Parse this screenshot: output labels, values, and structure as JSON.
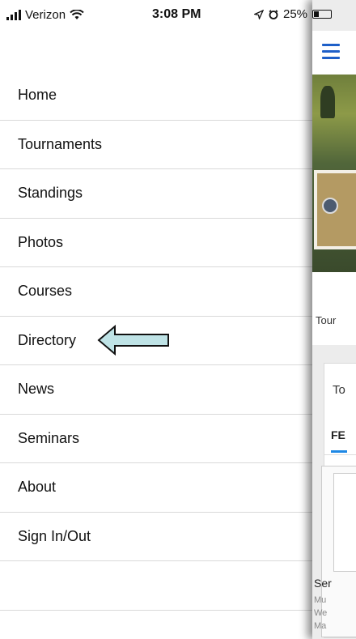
{
  "status_bar": {
    "carrier": "Verizon",
    "time": "3:08 PM",
    "battery": "25%"
  },
  "menu": {
    "items": [
      {
        "label": "Home"
      },
      {
        "label": "Tournaments"
      },
      {
        "label": "Standings"
      },
      {
        "label": "Photos"
      },
      {
        "label": "Courses"
      },
      {
        "label": "Directory"
      },
      {
        "label": "News"
      },
      {
        "label": "Seminars"
      },
      {
        "label": "About"
      },
      {
        "label": "Sign In/Out"
      }
    ]
  },
  "background_app": {
    "tour_label": "Tour",
    "card_title": "To",
    "tab_label": "FE",
    "item_title": "Ser",
    "item_lines": [
      "Mu",
      "We",
      "Ma"
    ]
  },
  "colors": {
    "accent": "#1e5fc8",
    "arrow_fill": "#bfe3e6"
  }
}
